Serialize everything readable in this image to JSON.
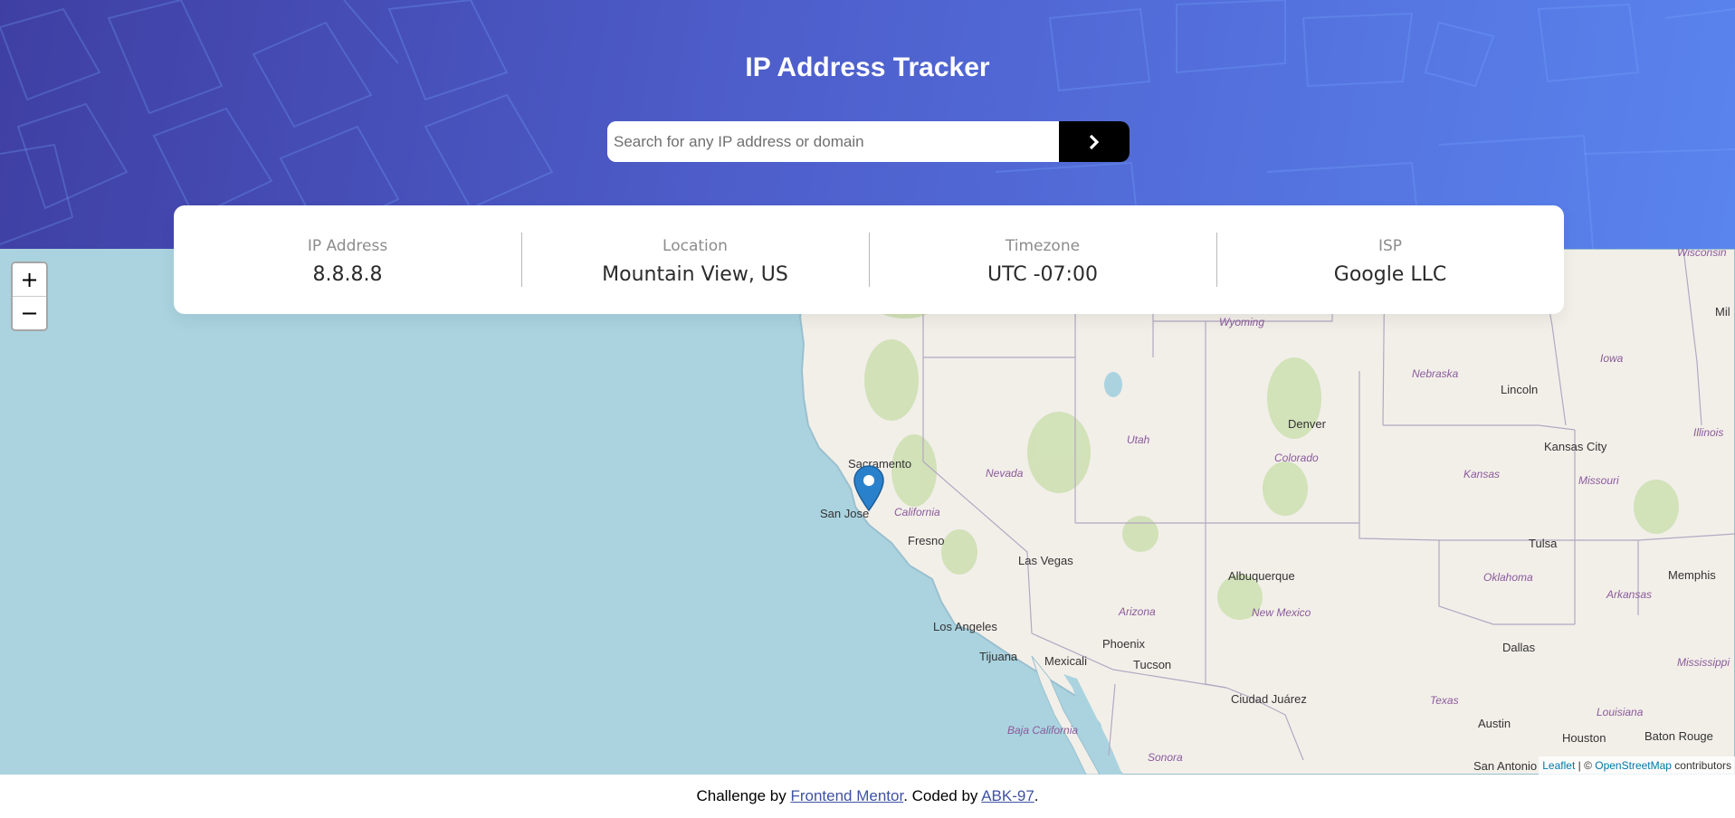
{
  "header": {
    "title": "IP Address Tracker",
    "search_placeholder": "Search for any IP address or domain",
    "search_button_icon": "chevron-right-icon"
  },
  "info": [
    {
      "label": "IP Address",
      "value": "8.8.8.8"
    },
    {
      "label": "Location",
      "value": "Mountain View, US"
    },
    {
      "label": "Timezone",
      "value": "UTC -07:00"
    },
    {
      "label": "ISP",
      "value": "Google LLC"
    }
  ],
  "map": {
    "zoom_in": "+",
    "zoom_out": "−",
    "marker_icon": "map-pin-icon",
    "cities": [
      "Sacramento",
      "San Jose",
      "Fresno",
      "Las Vegas",
      "Los Angeles",
      "Tijuana",
      "Mexicali",
      "Phoenix",
      "Tucson",
      "Albuquerque",
      "Denver",
      "Lincoln",
      "Kansas City",
      "Tulsa",
      "Memphis",
      "Dallas",
      "Austin",
      "Houston",
      "Baton Rouge",
      "San Antonio",
      "Ciudad Juárez",
      "Mil"
    ],
    "states": [
      "Wyoming",
      "Nebraska",
      "Iowa",
      "Illinois",
      "Wisconsin",
      "Utah",
      "Colorado",
      "Kansas",
      "Missouri",
      "Nevada",
      "California",
      "Oklahoma",
      "Arkansas",
      "Arizona",
      "New Mexico",
      "Texas",
      "Louisiana",
      "Mississippi",
      "Baja California",
      "Sonora"
    ],
    "attribution": {
      "leaflet": "Leaflet",
      "separator": " | © ",
      "osm": "OpenStreetMap",
      "contributors": " contributors"
    }
  },
  "footer": {
    "prefix": "Challenge by ",
    "frontend_mentor": "Frontend Mentor",
    "middle": ". Coded by ",
    "author": "ABK-97",
    "suffix": "."
  },
  "colors": {
    "header_start": "#3f3fa3",
    "header_end": "#5a84ee",
    "ocean": "#aad3df",
    "land": "#f2efe9",
    "button": "#000000",
    "marker": "#2a81cb"
  }
}
